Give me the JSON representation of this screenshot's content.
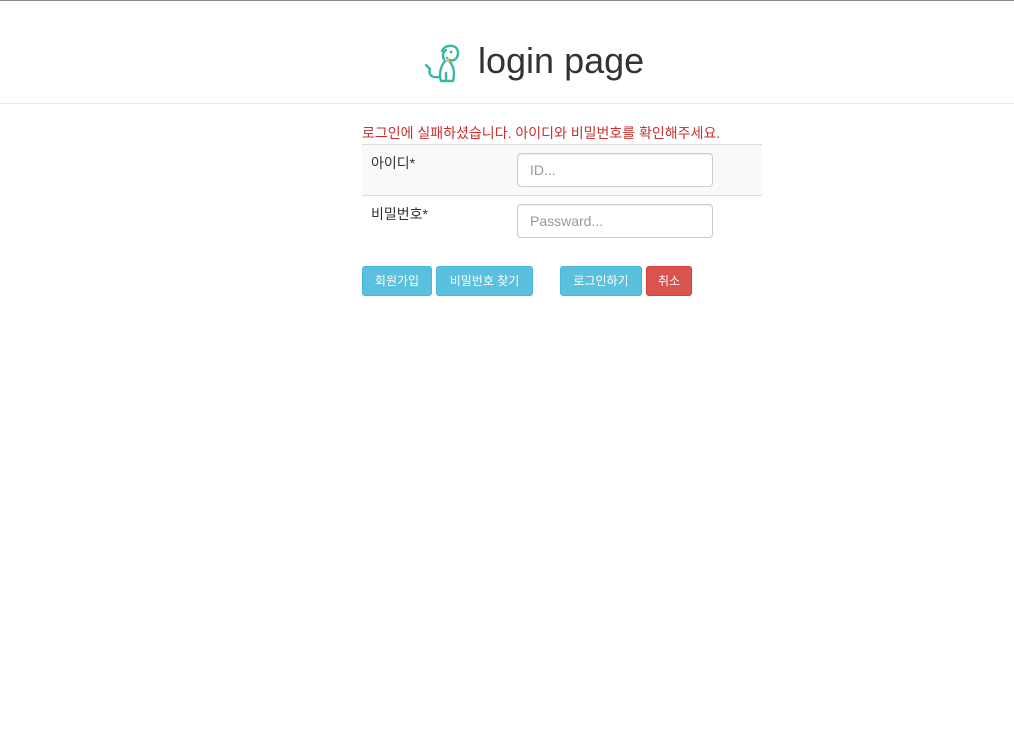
{
  "header": {
    "title": "login page",
    "logo_icon": "dog-icon",
    "logo_color": "#3bb5a5"
  },
  "error": {
    "message": "로그인에 실패하셨습니다. 아이디와 비밀번호를 확인해주세요.",
    "color": "#c9302c"
  },
  "form": {
    "id_label": "아이디*",
    "id_placeholder": "ID...",
    "id_value": "",
    "password_label": "비밀번호*",
    "password_placeholder": "Passward...",
    "password_value": ""
  },
  "buttons": {
    "join_label": "회원가입",
    "find_password_label": "비밀번호 찾기",
    "login_label": "로그인하기",
    "cancel_label": "취소",
    "info_color": "#5bc0de",
    "danger_color": "#d9534f"
  }
}
